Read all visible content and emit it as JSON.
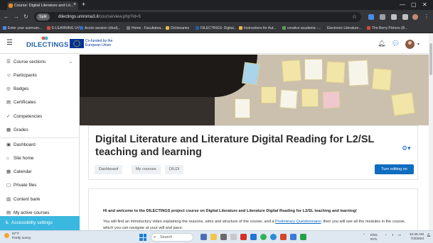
{
  "browser": {
    "tab_title": "Course: Digital Literature and Lit...",
    "address_prefix": "Split",
    "url_host": "dilectings.uniroma3.it",
    "url_path": "/course/view.php?id=5",
    "bookmarks": [
      {
        "label": "Enter your usernam...",
        "color": "#4a8be8"
      },
      {
        "label": "E-LEARNING UVT",
        "color": "#d64b3c"
      },
      {
        "label": "Accès session (étud)...",
        "color": "#2f6bd0"
      },
      {
        "label": "Home - Facultatea...",
        "color": "#7a7a7a"
      },
      {
        "label": "Dictionaries",
        "color": "#e6b84a"
      },
      {
        "label": "DILECTINGS: Digital...",
        "color": "#1f5fa8"
      },
      {
        "label": "Instructions for Aut...",
        "color": "#e6b84a"
      },
      {
        "label": "creative academic -...",
        "color": "#5d9c59"
      },
      {
        "label": "Electronic Literature...",
        "color": "#333333"
      },
      {
        "label": "The Berry Pickers (B...",
        "color": "#d64b3c"
      }
    ]
  },
  "header": {
    "logo": "DILECTINGS",
    "eu_text": "Co-funded by the European Union"
  },
  "drawer": {
    "items": [
      {
        "label": "Course sections",
        "icon": "list-icon",
        "glyph": "☰"
      },
      {
        "label": "Participants",
        "icon": "users-icon",
        "glyph": "👥"
      },
      {
        "label": "Badges",
        "icon": "badge-icon",
        "glyph": "◎"
      },
      {
        "label": "Certificates",
        "icon": "certificate-icon",
        "glyph": "▤"
      },
      {
        "label": "Competencies",
        "icon": "competencies-icon",
        "glyph": "✓"
      },
      {
        "label": "Grades",
        "icon": "grades-icon",
        "glyph": "▦"
      },
      {
        "label": "Dashboard",
        "icon": "dashboard-icon",
        "glyph": "▣"
      },
      {
        "label": "Site home",
        "icon": "home-icon",
        "glyph": "⌂"
      },
      {
        "label": "Calendar",
        "icon": "calendar-icon",
        "glyph": "▦"
      },
      {
        "label": "Private files",
        "icon": "file-icon",
        "glyph": "▢"
      },
      {
        "label": "Content bank",
        "icon": "content-bank-icon",
        "glyph": "▥"
      },
      {
        "label": "My active courses",
        "icon": "courses-icon",
        "glyph": "▤"
      }
    ],
    "accessibility": "Accessibility settings"
  },
  "course": {
    "title": "Digital Literature and Literature Digital Reading for L2/SL teaching and learning",
    "breadcrumbs": [
      "Dashboard",
      "My courses",
      "DILDI"
    ],
    "edit_button": "Turn editing on"
  },
  "content": {
    "welcome": "Hi and welcome to the DILECTINGS project course on Digital Literature and Literature Digital Reading for L2/SL teaching and learning!",
    "para_before": "You will find an introductory video explaining the reasons, aims and structure of the course, and a ",
    "para_link": "Preliminary Questionnaire",
    "para_after": "; then you will see all the modules in the course, which you can navigate at your will and pace."
  },
  "taskbar": {
    "temperature": "67°F",
    "weather": "Partly sunny",
    "search": "Search",
    "lang": "ENG",
    "lang_region": "INTL",
    "time": "10:45 AM",
    "date": "7/3/2024"
  }
}
